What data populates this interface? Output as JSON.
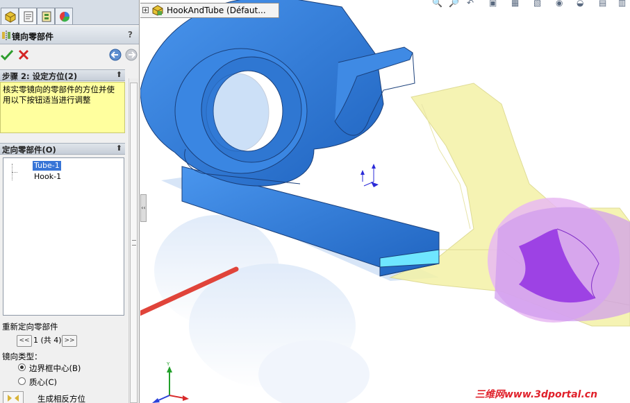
{
  "tabs": [
    {
      "name": "feature-manager"
    },
    {
      "name": "property-manager"
    },
    {
      "name": "configuration-manager"
    },
    {
      "name": "display-manager"
    }
  ],
  "property_manager": {
    "title": "镜向零部件",
    "help": "?"
  },
  "step_group": {
    "title": "步骤 2: 设定方位(2)",
    "message_line1": "核实零镜向的零部件的方位并使",
    "message_line2": "用以下按钮适当进行调整"
  },
  "orient_group": {
    "title": "定向零部件(O)",
    "items": [
      "Tube-1",
      "Hook-1"
    ],
    "selected_index": 0
  },
  "reorient": {
    "label": "重新定向零部件",
    "prev": "<<",
    "page": "1 (共 4)",
    "next": ">>"
  },
  "mirror_type": {
    "label": "镜向类型：",
    "options": [
      "边界框中心(B)",
      "质心(C)"
    ],
    "selected_index": 0
  },
  "generate_label": "生成相反方位",
  "tree": {
    "expand": "+",
    "name": "HookAndTube  (Défaut..."
  },
  "watermark": "三维网www.3dportal.cn",
  "colors": {
    "part_blue": "#2f7fd8",
    "mirror_yellow": "#f4f2a6",
    "mirror_purple": "#b46de8",
    "accent_red": "#e0202a"
  }
}
